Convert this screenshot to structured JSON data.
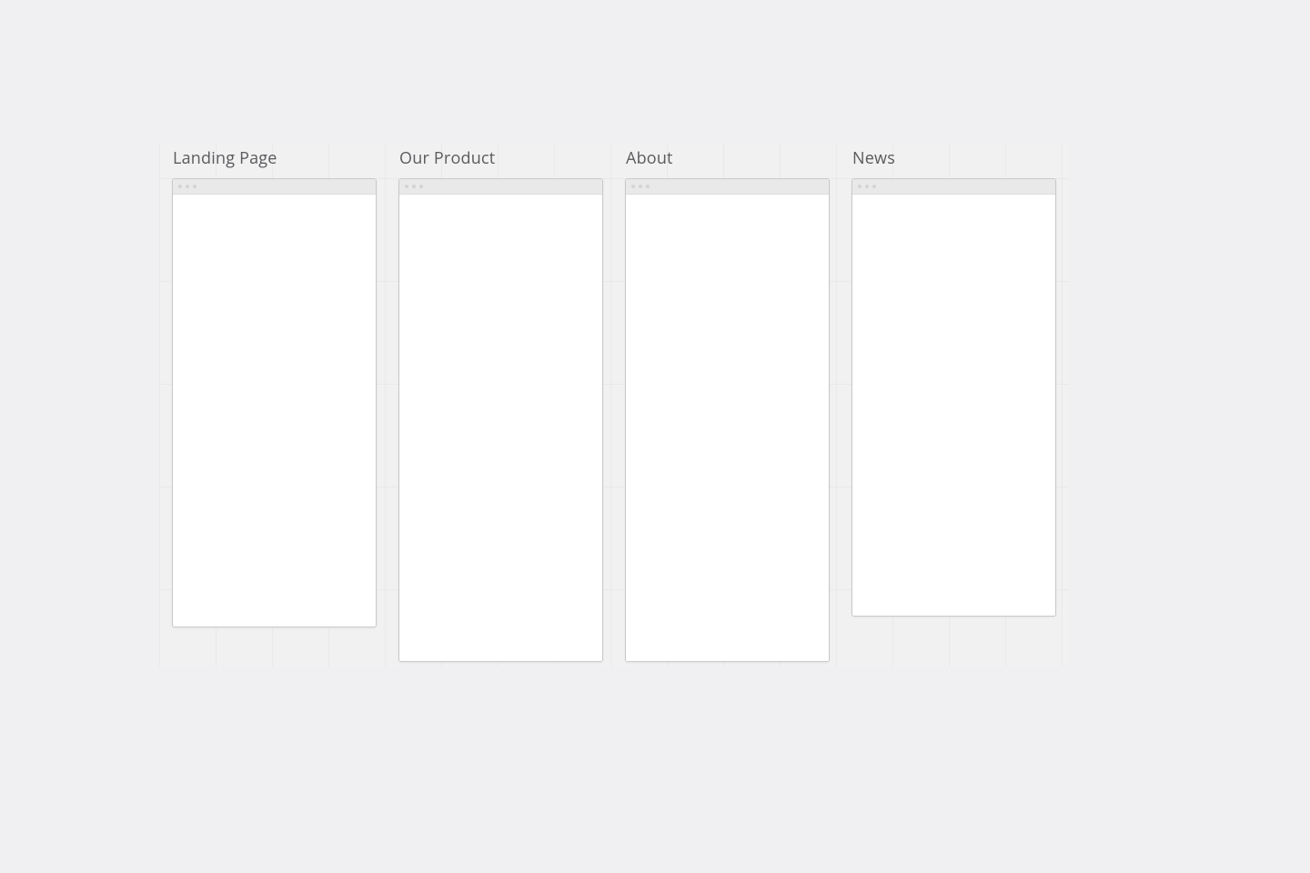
{
  "panels": [
    {
      "title": "Landing Page"
    },
    {
      "title": "Our Product"
    },
    {
      "title": "About"
    },
    {
      "title": "News"
    }
  ]
}
